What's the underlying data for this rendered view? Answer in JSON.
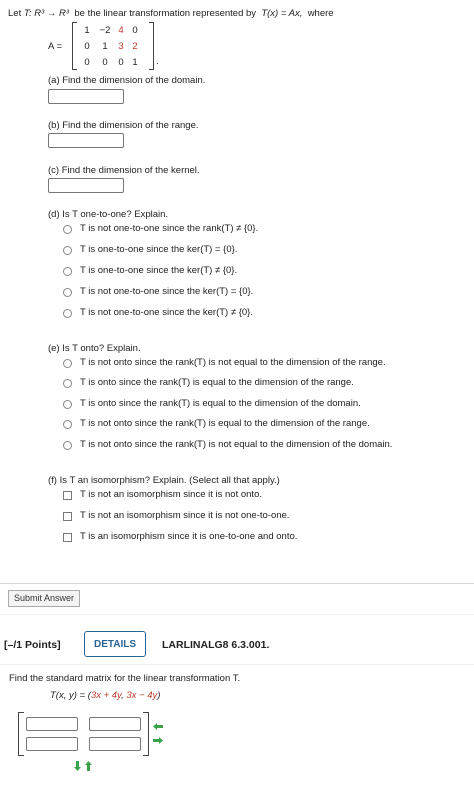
{
  "problem1": {
    "intro_pre": "Let",
    "intro_T": "T",
    "intro_map": ": R³ → R³",
    "intro_post": "be the linear transformation represented by",
    "intro_eq": "T(x) = Ax,",
    "intro_where": "where",
    "matrix_label": "A =",
    "matrix": [
      [
        "1",
        "−2",
        "4",
        "0"
      ],
      [
        "0",
        "1",
        "3",
        "2"
      ],
      [
        "0",
        "0",
        "0",
        "1"
      ]
    ],
    "qa": "(a) Find the dimension of the domain.",
    "qb": "(b) Find the dimension of the range.",
    "qc": "(c) Find the dimension of the kernel.",
    "qd": "(d) Is T one-to-one? Explain.",
    "d_options": [
      "T is not one-to-one since the rank(T) ≠ {0}.",
      "T is one-to-one since the ker(T) = {0}.",
      "T is one-to-one since the ker(T) ≠ {0}.",
      "T is not one-to-one since the ker(T) = {0}.",
      "T is not one-to-one since the ker(T) ≠ {0}."
    ],
    "qe": "(e) Is T onto? Explain.",
    "e_options": [
      "T is not onto since the rank(T) is not equal to the dimension of the range.",
      "T is onto since the rank(T) is equal to the dimension of the range.",
      "T is onto since the rank(T) is equal to the dimension of the domain.",
      "T is not onto since the rank(T) is equal to the dimension of the range.",
      "T is not onto since the rank(T) is not equal to the dimension of the domain."
    ],
    "qf": "(f) Is T an isomorphism? Explain. (Select all that apply.)",
    "f_options": [
      "T is not an isomorphism since it is not onto.",
      "T is not an isomorphism since it is not one-to-one.",
      "T is an isomorphism since it is one-to-one and onto."
    ],
    "submit_label": "Submit Answer"
  },
  "problem2": {
    "points": "[–/1 Points]",
    "details_label": "DETAILS",
    "code": "LARLINALG8 6.3.001.",
    "prompt": "Find the standard matrix for the linear transformation T.",
    "formula_lhs": "T(x, y) = (",
    "formula_a": "3x + 4y",
    "formula_sep": ", ",
    "formula_b": "3x − 4y",
    "formula_end": ")"
  },
  "colors": {
    "red": "#c0392b",
    "green": "#3aa34a",
    "details_border": "#2a6496"
  }
}
